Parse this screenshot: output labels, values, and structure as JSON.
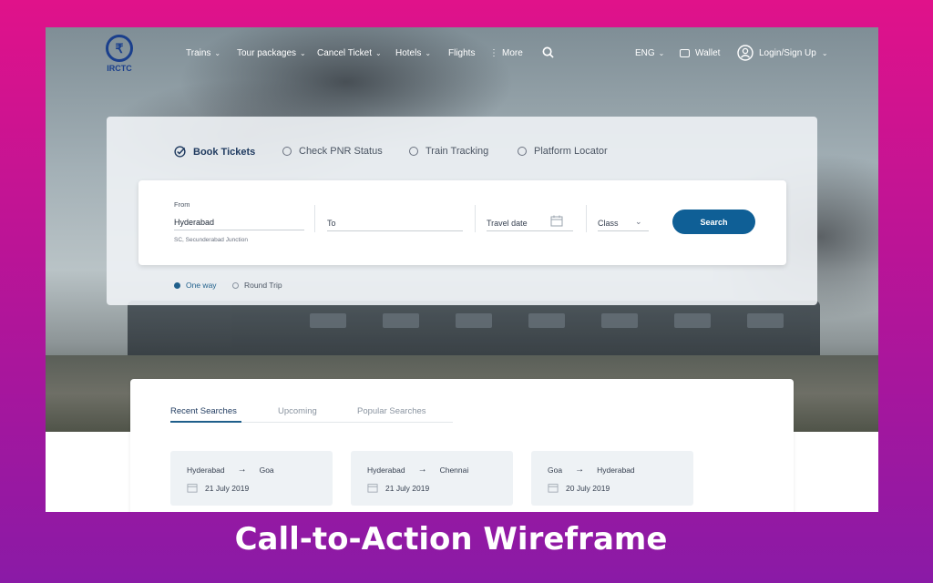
{
  "nav": {
    "logo_text": "IRCTC",
    "items": [
      {
        "label": "Trains",
        "has_menu": true
      },
      {
        "label": "Tour packages",
        "has_menu": true
      },
      {
        "label": "Cancel Ticket",
        "has_menu": true
      },
      {
        "label": "Hotels",
        "has_menu": true
      },
      {
        "label": "Flights",
        "has_menu": false
      },
      {
        "label": "More",
        "has_menu": false
      }
    ],
    "language": "ENG",
    "wallet": "Wallet",
    "login": "Login/Sign Up"
  },
  "booking": {
    "options": [
      "Book Tickets",
      "Check PNR Status",
      "Train Tracking",
      "Platform Locator"
    ],
    "active_option": "Book Tickets",
    "from_label": "From",
    "from_value": "Hyderabad",
    "from_sub": "SC, Secunderabad Junction",
    "to_placeholder": "To",
    "date_placeholder": "Travel date",
    "class_placeholder": "Class",
    "search_label": "Search",
    "trip_types": [
      "One way",
      "Round Trip"
    ],
    "selected_trip": "One way"
  },
  "recent": {
    "tabs": [
      "Recent Searches",
      "Upcoming",
      "Popular Searches"
    ],
    "active_tab": "Recent Searches",
    "cards": [
      {
        "from": "Hyderabad",
        "to": "Goa",
        "date": "21 July 2019"
      },
      {
        "from": "Hyderabad",
        "to": "Chennai",
        "date": "21 July 2019"
      },
      {
        "from": "Goa",
        "to": "Hyderabad",
        "date": "20 July 2019"
      }
    ]
  },
  "caption": "Call-to-Action Wireframe",
  "colors": {
    "accent": "#0f5f96",
    "brand": "#1a3f8c",
    "background_top": "#e0128a",
    "background_bottom": "#8a1aa6"
  }
}
